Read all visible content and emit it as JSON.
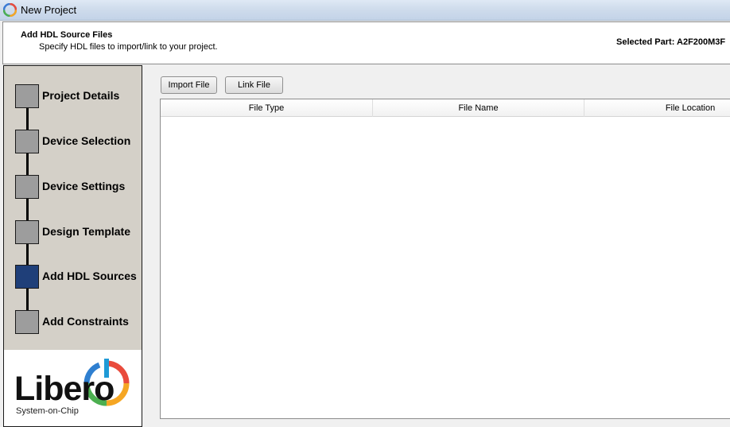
{
  "window": {
    "title": "New Project"
  },
  "header": {
    "title": "Add HDL Source Files",
    "subtitle": "Specify HDL files to import/link to your project.",
    "selected_part": "Selected Part: A2F200M3F"
  },
  "steps": [
    {
      "label": "Project Details",
      "active": false
    },
    {
      "label": "Device Selection",
      "active": false
    },
    {
      "label": "Device Settings",
      "active": false
    },
    {
      "label": "Design Template",
      "active": false
    },
    {
      "label": "Add HDL Sources",
      "active": true
    },
    {
      "label": "Add Constraints",
      "active": false
    }
  ],
  "logo": {
    "text": "Libero",
    "subtitle": "System-on-Chip"
  },
  "toolbar": {
    "import_label": "Import File",
    "link_label": "Link File"
  },
  "table": {
    "columns": [
      "File Type",
      "File Name",
      "File Location"
    ],
    "rows": []
  },
  "colors": {
    "active_step": "#1f3f79",
    "inactive_step": "#9d9d9d",
    "panel": "#d4d0c8"
  }
}
